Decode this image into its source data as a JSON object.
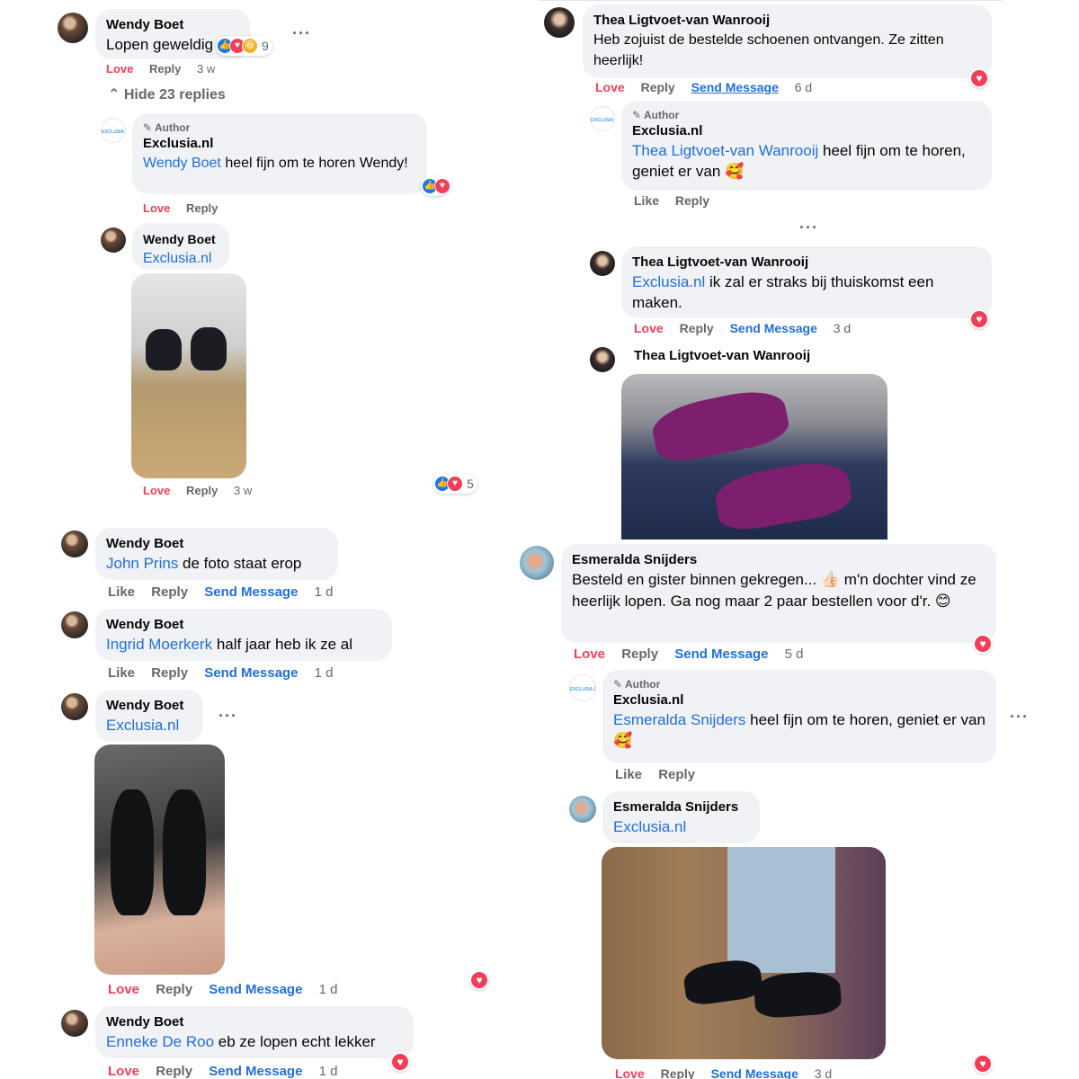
{
  "left": {
    "c1": {
      "name": "Wendy Boet",
      "text": "Lopen geweldig",
      "reactions_count": "9",
      "love": "Love",
      "reply": "Reply",
      "time": "3 w"
    },
    "hide_replies": "Hide 23 replies",
    "c2": {
      "author": "Author",
      "name": "Exclusia.nl",
      "mention": "Wendy Boet",
      "text": " heel fijn om te horen Wendy!",
      "love": "Love",
      "reply": "Reply"
    },
    "c3": {
      "name": "Wendy Boet",
      "mention": "Exclusia.nl",
      "love": "Love",
      "reply": "Reply",
      "time": "3 w",
      "reactions_count": "5"
    },
    "c4": {
      "name": "Wendy Boet",
      "mention": "John Prins",
      "text": " de foto staat erop",
      "like": "Like",
      "reply": "Reply",
      "send": "Send Message",
      "time": "1 d"
    },
    "c5": {
      "name": "Wendy Boet",
      "mention": "Ingrid Moerkerk",
      "text": " half jaar heb ik ze al",
      "like": "Like",
      "reply": "Reply",
      "send": "Send Message",
      "time": "1 d"
    },
    "c6": {
      "name": "Wendy Boet",
      "mention": "Exclusia.nl",
      "love": "Love",
      "reply": "Reply",
      "send": "Send Message",
      "time": "1 d"
    },
    "c7": {
      "name": "Wendy Boet",
      "mention": "Enneke De Roo",
      "text": " eb ze lopen echt lekker",
      "love": "Love",
      "reply": "Reply",
      "send": "Send Message",
      "time": "1 d"
    }
  },
  "right": {
    "c1": {
      "name": "Thea Ligtvoet-van Wanrooij",
      "text": "Heb zojuist de bestelde schoenen ontvangen. Ze zitten heerlijk!",
      "love": "Love",
      "reply": "Reply",
      "send": "Send Message",
      "time": "6 d"
    },
    "c2": {
      "author": "Author",
      "name": "Exclusia.nl",
      "mention": "Thea Ligtvoet-van Wanrooij",
      "text": " heel fijn om te horen, geniet er van 🥰",
      "like": "Like",
      "reply": "Reply"
    },
    "c3": {
      "name": "Thea Ligtvoet-van Wanrooij",
      "mention": "Exclusia.nl",
      "text": " ik zal er straks bij thuiskomst een maken.",
      "love": "Love",
      "reply": "Reply",
      "send": "Send Message",
      "time": "3 d"
    },
    "c4": {
      "name": "Thea Ligtvoet-van Wanrooij"
    },
    "c5": {
      "name": "Esmeralda Snijders",
      "text": "Besteld en gister binnen gekregen... 👍🏻 m'n dochter vind ze heerlijk lopen. Ga nog maar 2 paar bestellen voor d'r. 😊",
      "love": "Love",
      "reply": "Reply",
      "send": "Send Message",
      "time": "5 d"
    },
    "c6": {
      "author": "Author",
      "name": "Exclusia.nl",
      "mention": "Esmeralda Snijders",
      "text": " heel fijn om te horen, geniet er van 🥰",
      "like": "Like",
      "reply": "Reply"
    },
    "c7": {
      "name": "Esmeralda Snijders",
      "mention": "Exclusia.nl",
      "love": "Love",
      "reply": "Reply",
      "send": "Send Message",
      "time": "3 d"
    }
  },
  "icons": {
    "logo_text": "EXCLUSIA.NL",
    "accent": "#216fdb",
    "love_color": "#f33e58"
  }
}
